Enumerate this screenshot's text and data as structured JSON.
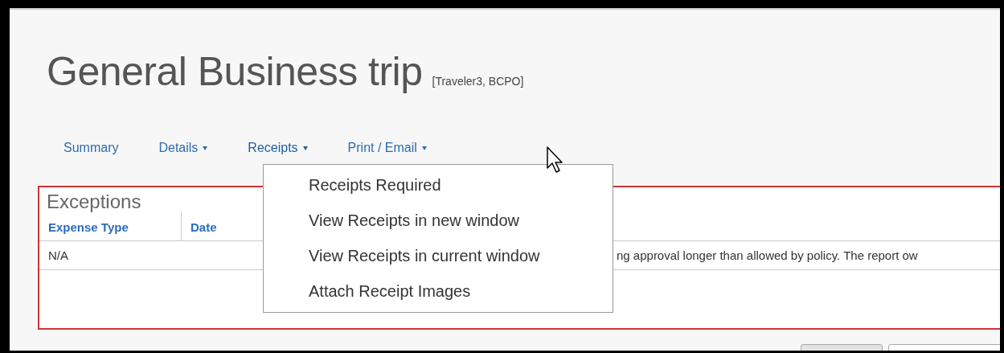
{
  "report": {
    "title": "General Business trip",
    "subtitle": "[Traveler3, BCPO]"
  },
  "nav": [
    {
      "label": "Summary",
      "has_menu": false,
      "expanded": false
    },
    {
      "label": "Details",
      "has_menu": true,
      "expanded": false
    },
    {
      "label": "Receipts",
      "has_menu": true,
      "expanded": true
    },
    {
      "label": "Print / Email",
      "has_menu": true,
      "expanded": false
    }
  ],
  "receipts_menu": [
    "Receipts Required",
    "View Receipts in new window",
    "View Receipts in current window",
    "Attach Receipt Images"
  ],
  "exceptions": {
    "title": "Exceptions",
    "columns": [
      "Expense Type",
      "Date"
    ],
    "rows": [
      {
        "expense_type": "N/A",
        "message": "ng approval longer than allowed by policy. The report ow"
      }
    ]
  }
}
